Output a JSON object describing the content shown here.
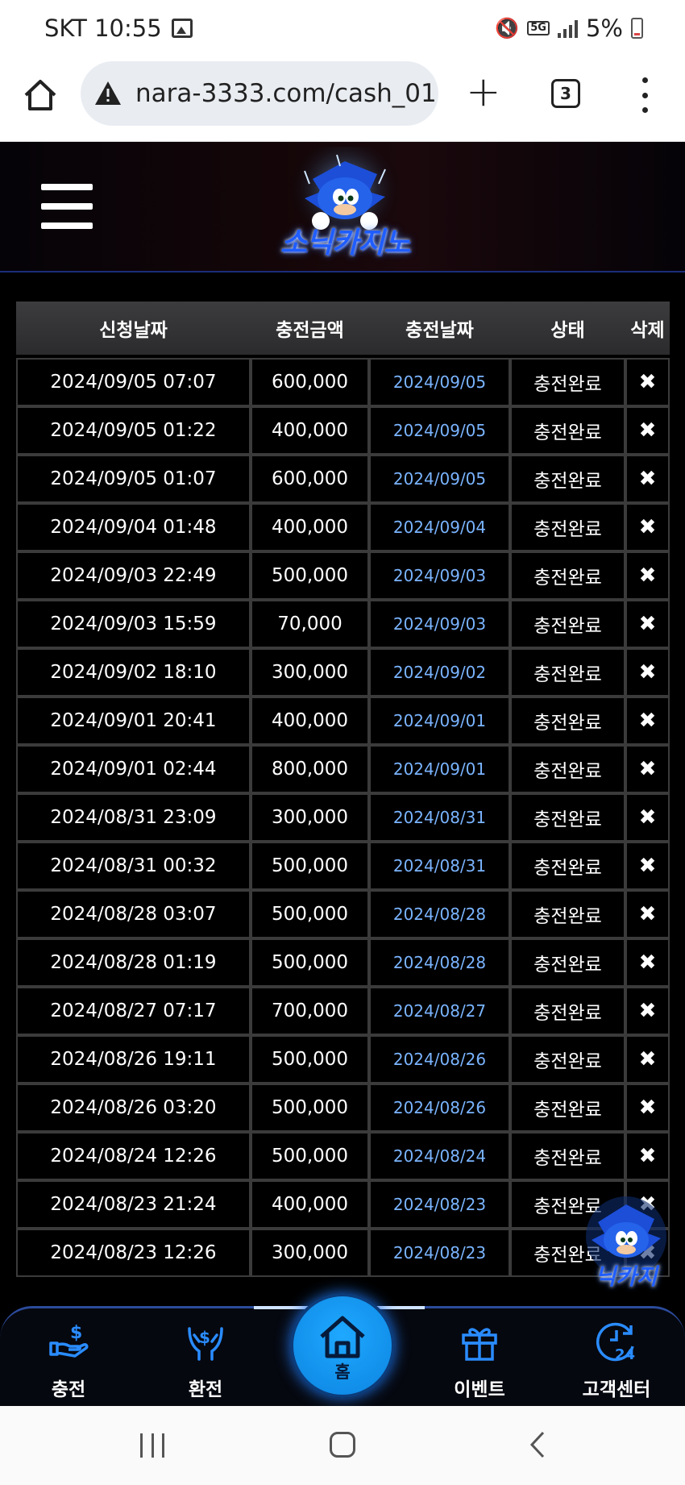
{
  "status_bar": {
    "carrier_time": "SKT 10:55",
    "network": "5G",
    "battery": "5%"
  },
  "browser": {
    "url": "nara-3333.com/cash_01.",
    "tab_count": "3"
  },
  "header": {
    "logo_text": "소닉카지노"
  },
  "table": {
    "headers": [
      "신청날짜",
      "충전금액",
      "충전날짜",
      "상태",
      "삭제"
    ],
    "rows": [
      {
        "request": "2024/09/05 07:07",
        "amount": "600,000",
        "date": "2024/09/05",
        "status": "충전완료",
        "delete": "✖"
      },
      {
        "request": "2024/09/05 01:22",
        "amount": "400,000",
        "date": "2024/09/05",
        "status": "충전완료",
        "delete": "✖"
      },
      {
        "request": "2024/09/05 01:07",
        "amount": "600,000",
        "date": "2024/09/05",
        "status": "충전완료",
        "delete": "✖"
      },
      {
        "request": "2024/09/04 01:48",
        "amount": "400,000",
        "date": "2024/09/04",
        "status": "충전완료",
        "delete": "✖"
      },
      {
        "request": "2024/09/03 22:49",
        "amount": "500,000",
        "date": "2024/09/03",
        "status": "충전완료",
        "delete": "✖"
      },
      {
        "request": "2024/09/03 15:59",
        "amount": "70,000",
        "date": "2024/09/03",
        "status": "충전완료",
        "delete": "✖"
      },
      {
        "request": "2024/09/02 18:10",
        "amount": "300,000",
        "date": "2024/09/02",
        "status": "충전완료",
        "delete": "✖"
      },
      {
        "request": "2024/09/01 20:41",
        "amount": "400,000",
        "date": "2024/09/01",
        "status": "충전완료",
        "delete": "✖"
      },
      {
        "request": "2024/09/01 02:44",
        "amount": "800,000",
        "date": "2024/09/01",
        "status": "충전완료",
        "delete": "✖"
      },
      {
        "request": "2024/08/31 23:09",
        "amount": "300,000",
        "date": "2024/08/31",
        "status": "충전완료",
        "delete": "✖"
      },
      {
        "request": "2024/08/31 00:32",
        "amount": "500,000",
        "date": "2024/08/31",
        "status": "충전완료",
        "delete": "✖"
      },
      {
        "request": "2024/08/28 03:07",
        "amount": "500,000",
        "date": "2024/08/28",
        "status": "충전완료",
        "delete": "✖"
      },
      {
        "request": "2024/08/28 01:19",
        "amount": "500,000",
        "date": "2024/08/28",
        "status": "충전완료",
        "delete": "✖"
      },
      {
        "request": "2024/08/27 07:17",
        "amount": "700,000",
        "date": "2024/08/27",
        "status": "충전완료",
        "delete": "✖"
      },
      {
        "request": "2024/08/26 19:11",
        "amount": "500,000",
        "date": "2024/08/26",
        "status": "충전완료",
        "delete": "✖"
      },
      {
        "request": "2024/08/26 03:20",
        "amount": "500,000",
        "date": "2024/08/26",
        "status": "충전완료",
        "delete": "✖"
      },
      {
        "request": "2024/08/24 12:26",
        "amount": "500,000",
        "date": "2024/08/24",
        "status": "충전완료",
        "delete": "✖"
      },
      {
        "request": "2024/08/23 21:24",
        "amount": "400,000",
        "date": "2024/08/23",
        "status": "충전완료",
        "delete": "✖"
      },
      {
        "request": "2024/08/23 12:26",
        "amount": "300,000",
        "date": "2024/08/23",
        "status": "충전완료",
        "delete": "✖"
      }
    ]
  },
  "floating_widget": {
    "text": "닉카지"
  },
  "bottom_nav": {
    "charge": "충전",
    "exchange": "환전",
    "home": "홈",
    "event": "이벤트",
    "support": "고객센터"
  },
  "colors": {
    "accent_blue": "#1fa8ff",
    "date_blue": "#7ab4ff",
    "nav_icon_blue": "#2a8cff"
  }
}
